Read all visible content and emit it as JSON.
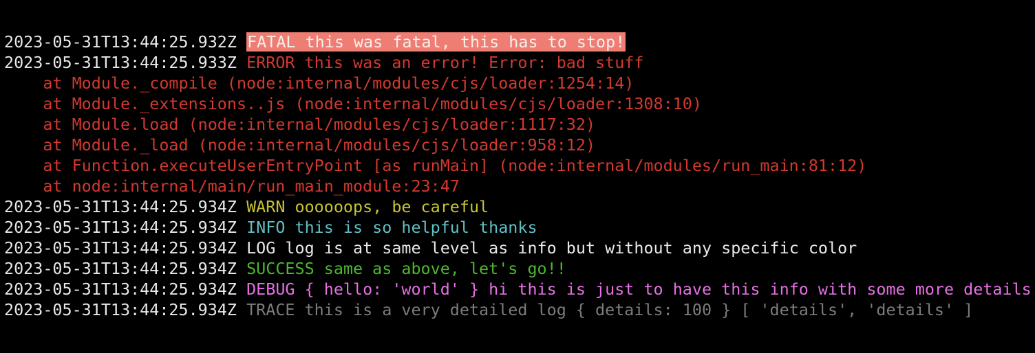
{
  "log": {
    "lines": [
      {
        "timestamp": "2023-05-31T13:44:25.932Z",
        "level": "fatal",
        "message": "FATAL this was fatal, this has to stop!",
        "color": "#f8efe9",
        "background": "#ee7d74"
      },
      {
        "timestamp": "2023-05-31T13:44:25.933Z",
        "level": "error",
        "message": "ERROR this was an error! Error: bad stuff",
        "color": "#d2392f"
      },
      {
        "timestamp": "",
        "level": "stack",
        "message": "    at Module._compile (node:internal/modules/cjs/loader:1254:14)",
        "color": "#d2392f"
      },
      {
        "timestamp": "",
        "level": "stack",
        "message": "    at Module._extensions..js (node:internal/modules/cjs/loader:1308:10)",
        "color": "#d2392f"
      },
      {
        "timestamp": "",
        "level": "stack",
        "message": "    at Module.load (node:internal/modules/cjs/loader:1117:32)",
        "color": "#d2392f"
      },
      {
        "timestamp": "",
        "level": "stack",
        "message": "    at Module._load (node:internal/modules/cjs/loader:958:12)",
        "color": "#d2392f"
      },
      {
        "timestamp": "",
        "level": "stack",
        "message": "    at Function.executeUserEntryPoint [as runMain] (node:internal/modules/run_main:81:12)",
        "color": "#d2392f"
      },
      {
        "timestamp": "",
        "level": "stack",
        "message": "    at node:internal/main/run_main_module:23:47",
        "color": "#d2392f"
      },
      {
        "timestamp": "2023-05-31T13:44:25.934Z",
        "level": "warn",
        "message": "WARN oooooops, be careful",
        "color": "#c7c432"
      },
      {
        "timestamp": "2023-05-31T13:44:25.934Z",
        "level": "info",
        "message": "INFO this is so helpful thanks",
        "color": "#5fbfc4"
      },
      {
        "timestamp": "2023-05-31T13:44:25.934Z",
        "level": "log",
        "message": "LOG log is at same level as info but without any specific color",
        "color": "#e8e8e8"
      },
      {
        "timestamp": "2023-05-31T13:44:25.934Z",
        "level": "success",
        "message": "SUCCESS same as above, let's go!!",
        "color": "#4cb82d"
      },
      {
        "timestamp": "2023-05-31T13:44:25.934Z",
        "level": "debug",
        "message": "DEBUG { hello: 'world' } hi this is just to have this info with some more details",
        "color": "#e570e4"
      },
      {
        "timestamp": "2023-05-31T13:44:25.934Z",
        "level": "trace",
        "message": "TRACE this is a very detailed log { details: 100 } [ 'details', 'details' ]",
        "color": "#7c7c7c"
      }
    ]
  }
}
